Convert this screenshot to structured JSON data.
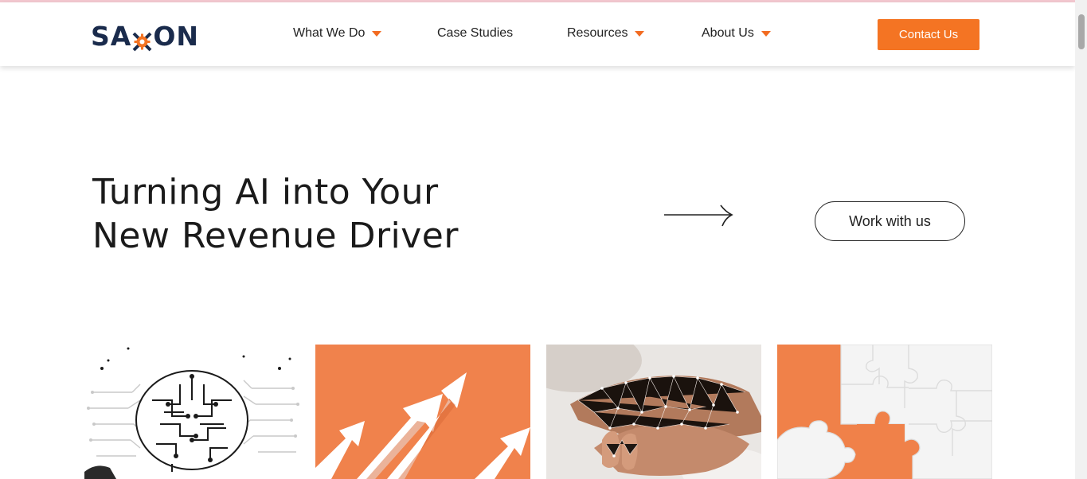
{
  "header": {
    "logo_text_left": "SA",
    "logo_text_right": "ON",
    "nav": [
      {
        "label": "What We Do",
        "dropdown": true
      },
      {
        "label": "Case Studies",
        "dropdown": false
      },
      {
        "label": "Resources",
        "dropdown": true
      },
      {
        "label": "About Us",
        "dropdown": true
      }
    ],
    "contact_label": "Contact Us"
  },
  "hero": {
    "title_line1": "Turning AI into Your",
    "title_line2": "New Revenue Driver",
    "cta_label": "Work with us"
  },
  "cards": [
    {
      "icon": "ai-brain-circuit-image"
    },
    {
      "icon": "growth-arrows-image"
    },
    {
      "icon": "digital-handshake-image"
    },
    {
      "icon": "puzzle-pieces-image"
    }
  ],
  "colors": {
    "accent": "#f47423",
    "navy": "#1a2b4c",
    "text": "#1f1f1f"
  }
}
